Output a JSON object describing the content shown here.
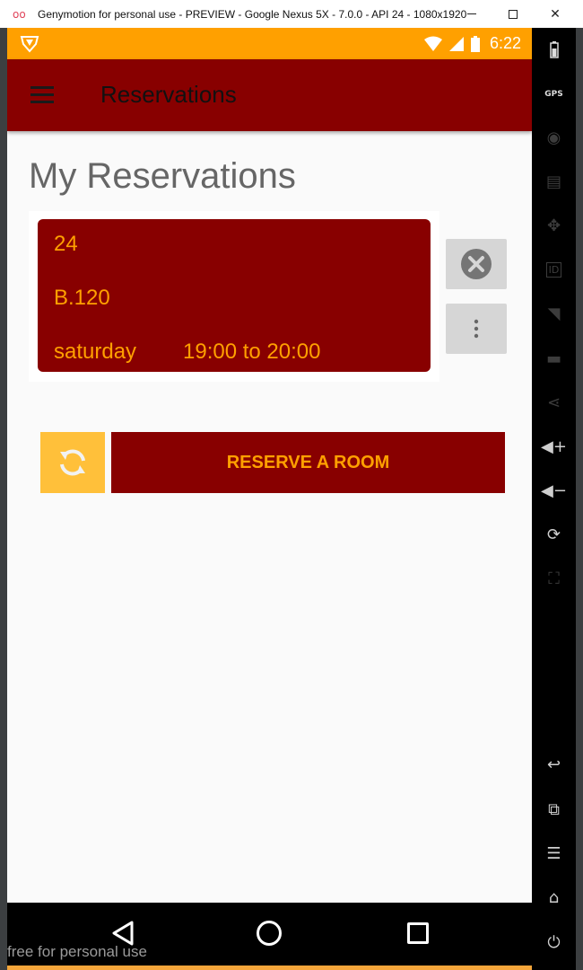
{
  "window": {
    "title": "Genymotion for personal use - PREVIEW - Google Nexus 5X - 7.0.0 - API 24 - 1080x1920 ..."
  },
  "statusbar": {
    "time": "6:22"
  },
  "appbar": {
    "title": "Reservations"
  },
  "page": {
    "title": "My Reservations"
  },
  "reservation": {
    "number": "24",
    "room": "B.120",
    "day": "saturday",
    "time": "19:00 to 20:00"
  },
  "actions": {
    "reserve_label": "RESERVE A ROOM"
  },
  "toolbar": {
    "gps_label": "GPS",
    "id_label": "ID"
  },
  "watermark": "free for personal use",
  "colors": {
    "primary": "#880000",
    "accent": "#ffa000",
    "refresh": "#ffc03a"
  },
  "icons": {
    "menu": "hamburger-icon",
    "cancel": "close-circle-icon",
    "more": "more-vertical-icon",
    "refresh": "refresh-icon"
  }
}
